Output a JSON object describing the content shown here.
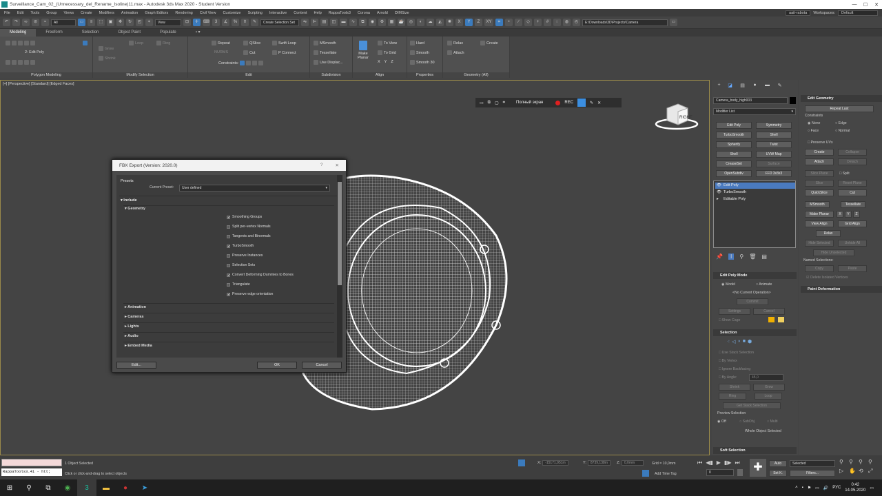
{
  "window": {
    "title": "Surveillance_Cam_02_(Unnecessary_del_Rename_Isoline)11.max - Autodesk 3ds Max 2020 - Student Version"
  },
  "menu": {
    "items": [
      "File",
      "Edit",
      "Tools",
      "Group",
      "Views",
      "Create",
      "Modifiers",
      "Animation",
      "Graph Editors",
      "Rendering",
      "Civil View",
      "Customize",
      "Scripting",
      "Interactive",
      "Content",
      "Help",
      "RappaTools3",
      "Corona",
      "Arnold",
      "DIMSize"
    ],
    "user": "aait-rabota",
    "workspaces_label": "Workspaces:",
    "workspace": "Default"
  },
  "toolbar": {
    "filter_all": "All",
    "view_dropdown": "View",
    "selection_set": "Create Selection Set",
    "axis_x": "X",
    "axis_y": "Y",
    "axis_z": "Z",
    "axis_xy": "XY",
    "path": "E:\\Downloads\\3D\\Projects\\Camera"
  },
  "ribbon_tabs": [
    "Modeling",
    "Freeform",
    "Selection",
    "Object Paint",
    "Populate"
  ],
  "ribbon": {
    "poly_mode_label": "2: Edit Poly",
    "polygon_modeling": "Polygon Modeling",
    "modify_selection": "Modify Selection",
    "grow": "Grow",
    "shrink": "Shrink",
    "loop": "Loop",
    "ring": "Ring",
    "edit": "Edit",
    "repeat": "Repeat",
    "qslice": "QSlice",
    "swift_loop": "Swift Loop",
    "nurms": "NURMS",
    "cut": "Cut",
    "p_connect": "P Connect",
    "constraints": "Constraints:",
    "subdivision": "Subdivision",
    "msmooth": "MSmooth",
    "tessellate": "Tessellate",
    "use_displac": "Use Displac...",
    "make_planar": "Make Planar",
    "align": "Align",
    "to_view": "To View",
    "to_grid": "To Grid",
    "x": "X",
    "y": "Y",
    "z": "Z",
    "properties": "Properties",
    "hard": "Hard",
    "smooth": "Smooth",
    "smooth30": "Smooth 30",
    "geometry_all": "Geometry (All)",
    "relax": "Relax",
    "create": "Create",
    "attach": "Attach"
  },
  "viewport": {
    "label": "[+] [Perspective] [Standard] [Edged Faces]",
    "recbar_fullscreen": "Полный экран",
    "recbar_rec": "REC",
    "viewcube_label": "RIGHT"
  },
  "dialog": {
    "title": "FBX Export (Version: 2020.0)",
    "help": "?",
    "close": "✕",
    "presets": "Presets",
    "current_preset_label": "Current Preset:",
    "current_preset": "User defined",
    "include": "Include",
    "geometry": "Geometry",
    "options": [
      {
        "label": "Smoothing Groups",
        "checked": true
      },
      {
        "label": "Split per-vertex Normals",
        "checked": false
      },
      {
        "label": "Tangents and Binormals",
        "checked": false
      },
      {
        "label": "TurboSmooth",
        "checked": true
      },
      {
        "label": "Preserve Instances",
        "checked": false
      },
      {
        "label": "Selection Sets",
        "checked": false
      },
      {
        "label": "Convert Deforming Dummies to Bones",
        "checked": true
      },
      {
        "label": "Triangulate",
        "checked": false
      },
      {
        "label": "Preserve edge orientation",
        "checked": true
      }
    ],
    "sections": [
      "Animation",
      "Cameras",
      "Lights",
      "Audio",
      "Embed Media"
    ],
    "edit_button": "Edit...",
    "ok_button": "OK",
    "cancel_button": "Cancel"
  },
  "command_panel": {
    "object_name": "Camera_body_high003",
    "modifier_list": "Modifier List",
    "mod_buttons": [
      "Edit Poly",
      "Symmetry",
      "TurboSmooth",
      "Shell",
      "Spherify",
      "Twist",
      "Shell",
      "UVW Map",
      "CreaseSet",
      "Surface",
      "OpenSubdiv",
      "FFD 3x3x3"
    ],
    "stack": [
      "Edit Poly",
      "TurboSmooth",
      "Editable Poly"
    ],
    "edit_poly_mode": "Edit Poly Mode",
    "model": "Model",
    "animate": "Animate",
    "no_current_op": "<No Current Operation>",
    "commit": "Commit",
    "settings": "Settings",
    "cancel": "Cancel",
    "show_cage": "Show Cage",
    "selection": "Selection",
    "use_stack_selection": "Use Stack Selection",
    "by_vertex": "By Vertex",
    "ignore_backfacing": "Ignore Backfacing",
    "by_angle": "By Angle:",
    "angle_value": "45,0",
    "shrink": "Shrink",
    "grow": "Grow",
    "ring": "Ring",
    "loop": "Loop",
    "get_stack_selection": "Get Stack Selection",
    "preview_selection": "Preview Selection",
    "off": "Off",
    "subobj": "SubObj",
    "multi": "Multi",
    "whole_object": "Whole Object Selected",
    "soft_selection": "Soft Selection"
  },
  "edit_geometry": {
    "title": "Edit Geometry",
    "repeat_last": "Repeat Last",
    "constraints": "Constraints",
    "none": "None",
    "edge": "Edge",
    "face": "Face",
    "normal": "Normal",
    "preserve_uvs": "Preserve UVs",
    "create": "Create",
    "collapse": "Collapse",
    "attach": "Attach",
    "detach": "Detach",
    "slice_plane": "Slice Plane",
    "split": "Split",
    "slice": "Slice",
    "reset_plane": "Reset Plane",
    "quickslice": "QuickSlice",
    "cut": "Cut",
    "msmooth": "MSmooth",
    "tessellate": "Tessellate",
    "make_planar": "Make Planar",
    "x": "X",
    "y": "Y",
    "z": "Z",
    "view_align": "View Align",
    "grid_align": "Grid Align",
    "relax": "Relax",
    "hide_selected": "Hide Selected",
    "unhide_all": "Unhide All",
    "hide_unselected": "Hide Unselected",
    "named_selections": "Named Selections:",
    "copy": "Copy",
    "paste": "Paste",
    "delete_isolated": "Delete Isolated Vertices",
    "paint_deformation": "Paint Deformation"
  },
  "status": {
    "maxscript": "RappaTools3.41 - htt;",
    "objects_selected": "1 Object Selected",
    "prompt": "Click or click-and-drag to select objects",
    "x_label": "X:",
    "x_value": "-15171,951m",
    "y_label": "Y:",
    "y_value": "8739,138m",
    "z_label": "Z:",
    "z_value": "0,0mm",
    "grid": "Grid = 10,0mm",
    "add_time_tag": "Add Time Tag",
    "frame": "0",
    "auto": "Auto",
    "selected": "Selected",
    "set_k": "Set K.",
    "filters": "Filters..."
  },
  "taskbar": {
    "lang": "РУС",
    "time": "0:42",
    "date": "14.05.2020"
  }
}
